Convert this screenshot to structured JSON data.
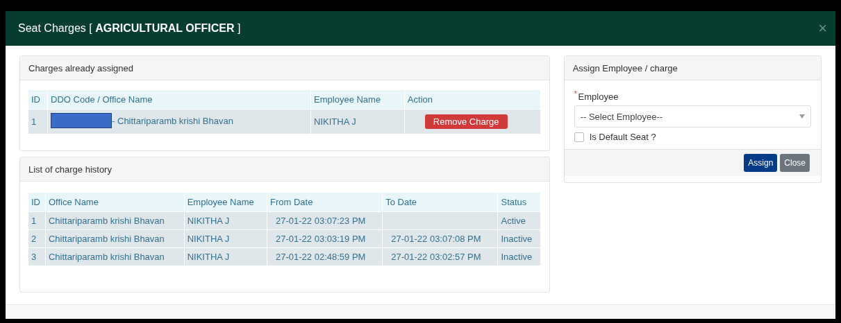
{
  "modal": {
    "title": "Seat Charges [ **AGRICULTURAL OFFICER** ]",
    "close": "×"
  },
  "assigned": {
    "heading": "Charges already assigned",
    "columns": [
      "ID",
      "DDO Code / Office Name",
      "Employee Name",
      "Action"
    ],
    "rows": [
      {
        "id": "1",
        "office": "- Chittariparamb krishi Bhavan",
        "redacted": true,
        "employee": "NIKITHA J",
        "action": "Remove Charge"
      }
    ]
  },
  "history": {
    "heading": "List of charge history",
    "columns": [
      "ID",
      "Office Name",
      "Employee Name",
      "From Date",
      "To Date",
      "Status"
    ],
    "rows": [
      {
        "id": "1",
        "office": "Chittariparamb krishi Bhavan",
        "employee": "NIKITHA J",
        "from": "27-01-22 03:07:23 PM",
        "to": "",
        "status": "Active"
      },
      {
        "id": "2",
        "office": "Chittariparamb krishi Bhavan",
        "employee": "NIKITHA J",
        "from": "27-01-22 03:03:19 PM",
        "to": "27-01-22 03:07:08 PM",
        "status": "Inactive"
      },
      {
        "id": "3",
        "office": "Chittariparamb krishi Bhavan",
        "employee": "NIKITHA J",
        "from": "27-01-22 02:48:59 PM",
        "to": "27-01-22 03:02:57 PM",
        "status": "Inactive"
      }
    ]
  },
  "assign": {
    "heading": "Assign Employee / charge",
    "required_mark": "*",
    "label": "Employee",
    "select": {
      "value": "-- Select Employee--"
    },
    "default_seat": {
      "label": "Is Default Seat ?",
      "checked": false
    },
    "buttons": [
      {
        "label": "Assign",
        "kind": "primary"
      },
      {
        "label": "Close",
        "kind": "secondary"
      }
    ]
  }
}
